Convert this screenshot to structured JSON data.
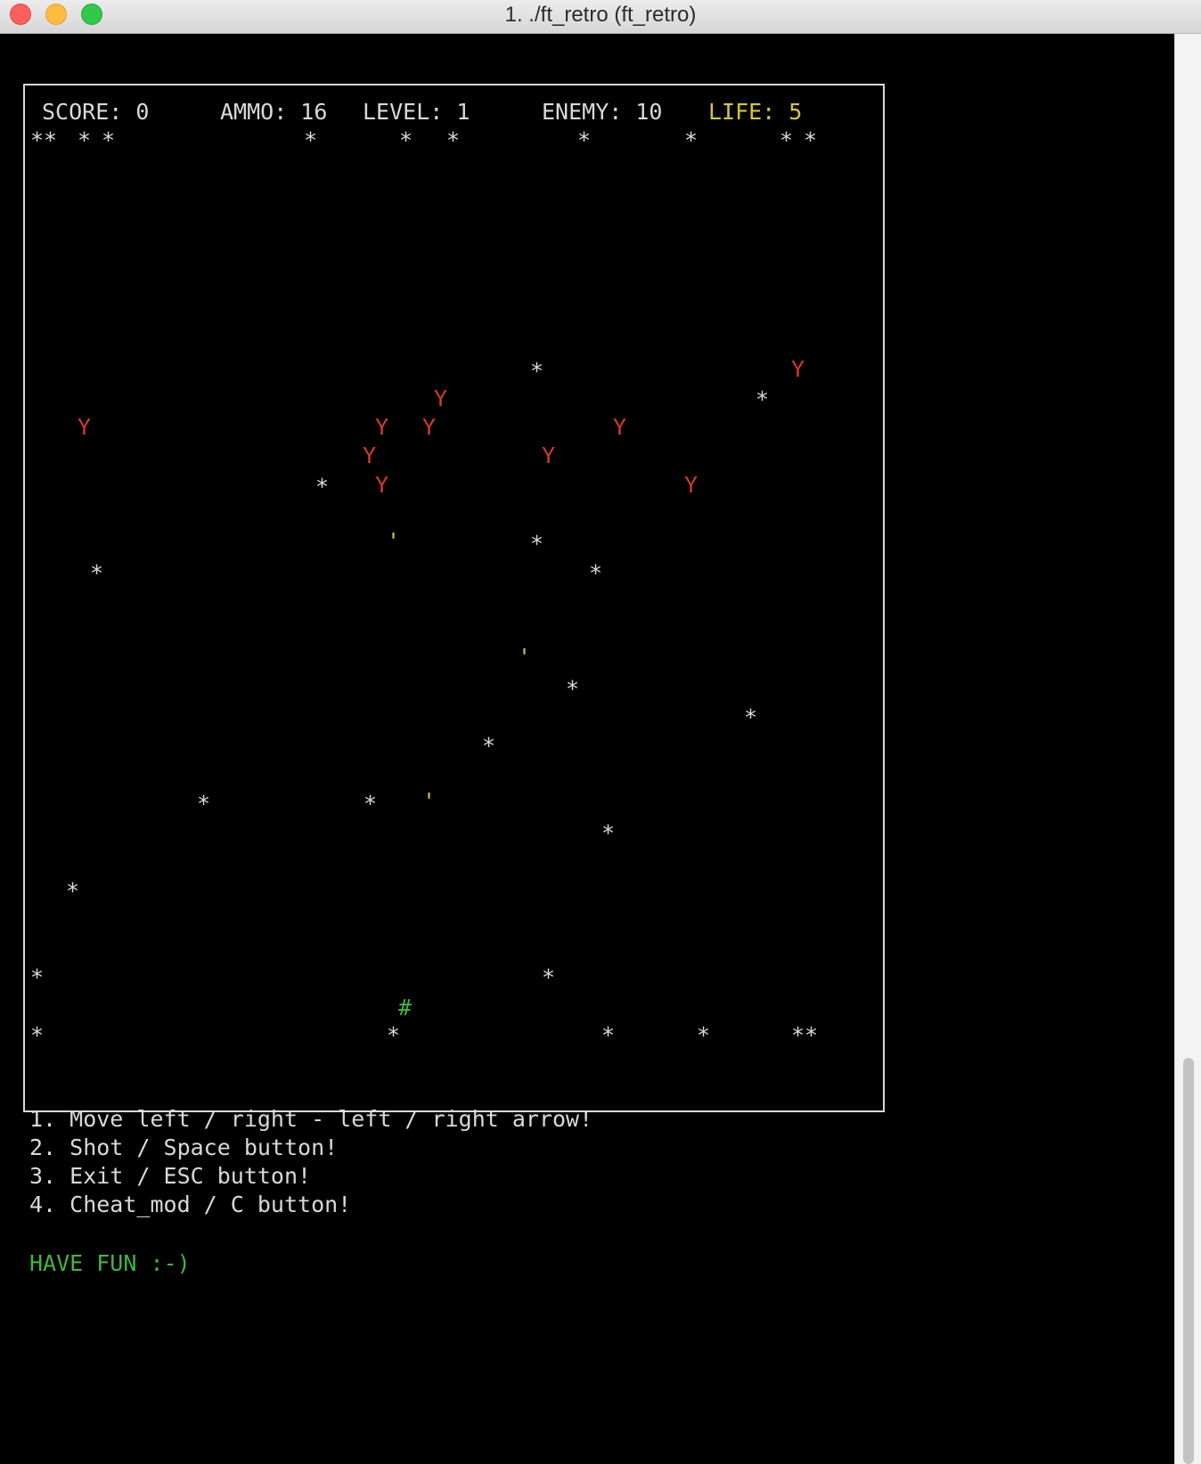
{
  "window": {
    "title": "1. ./ft_retro (ft_retro)"
  },
  "hud": {
    "score": "SCORE: 0",
    "ammo": "AMMO: 16",
    "level": "LEVEL: 1",
    "enemy": "ENEMY: 10",
    "life": "LIFE: 5"
  },
  "glyphs": {
    "star": "*",
    "double_star": "**",
    "enemy": "Y",
    "bullet": "'",
    "player": "#"
  },
  "instructions": [
    "1. Move left / right - left / right arrow!",
    "2. Shot / Space button!",
    "3. Exit / ESC button!",
    "4. Cheat_mod / C button!"
  ],
  "have_fun": "HAVE FUN :-)",
  "colors": {
    "background": "#000000",
    "text": "#d9d9d9",
    "enemy": "#d23a2a",
    "life": "#d6c737",
    "player": "#3fb73f"
  }
}
